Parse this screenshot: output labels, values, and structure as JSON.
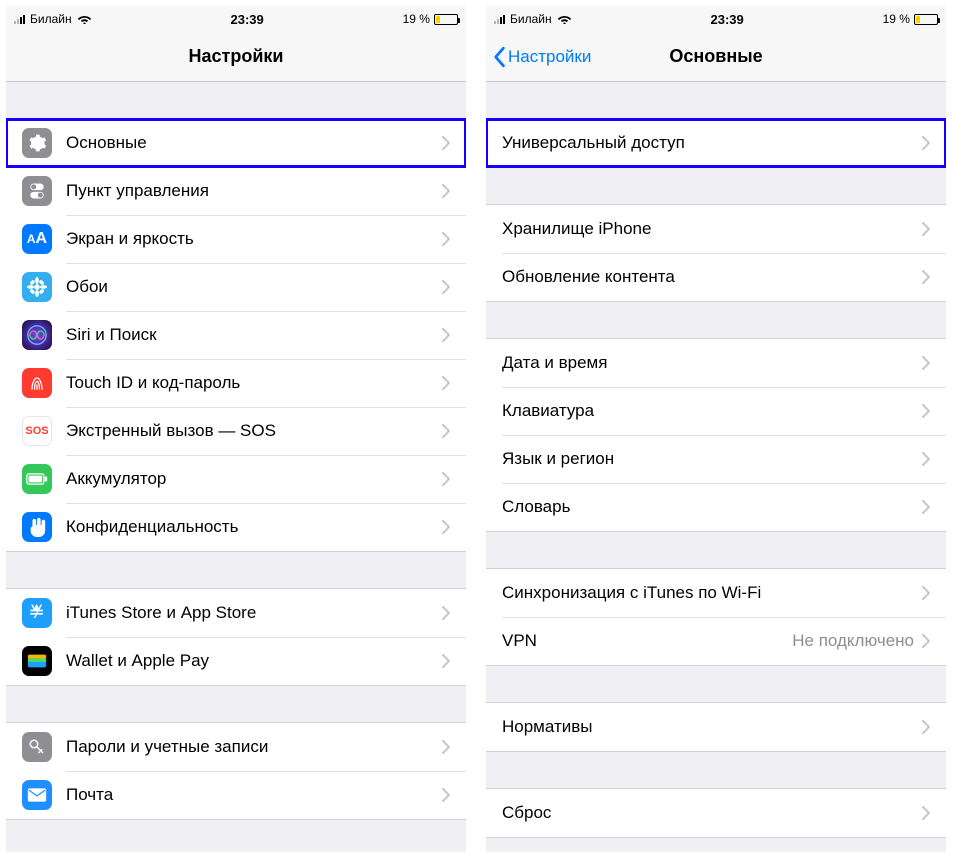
{
  "status": {
    "carrier": "Билайн",
    "time": "23:39",
    "battery_pct_text": "19 %",
    "battery_fill_width": "19%"
  },
  "left": {
    "title": "Настройки",
    "groups": [
      {
        "rows": [
          {
            "icon": "general",
            "label": "Основные",
            "highlight": true
          },
          {
            "icon": "control",
            "label": "Пункт управления"
          },
          {
            "icon": "display",
            "label": "Экран и яркость"
          },
          {
            "icon": "wallpaper",
            "label": "Обои"
          },
          {
            "icon": "siri",
            "label": "Siri и Поиск"
          },
          {
            "icon": "touchid",
            "label": "Touch ID и код-пароль"
          },
          {
            "icon": "sos",
            "label": "Экстренный вызов — SOS"
          },
          {
            "icon": "battery",
            "label": "Аккумулятор"
          },
          {
            "icon": "privacy",
            "label": "Конфиденциальность"
          }
        ]
      },
      {
        "rows": [
          {
            "icon": "appstore",
            "label": "iTunes Store и App Store"
          },
          {
            "icon": "wallet",
            "label": "Wallet и Apple Pay"
          }
        ]
      },
      {
        "rows": [
          {
            "icon": "passwords",
            "label": "Пароли и учетные записи"
          },
          {
            "icon": "mail",
            "label": "Почта"
          }
        ]
      }
    ]
  },
  "right": {
    "back": "Настройки",
    "title": "Основные",
    "groups": [
      {
        "rows": [
          {
            "label": "Универсальный доступ",
            "highlight": true
          }
        ]
      },
      {
        "rows": [
          {
            "label": "Хранилище iPhone"
          },
          {
            "label": "Обновление контента"
          }
        ]
      },
      {
        "rows": [
          {
            "label": "Дата и время"
          },
          {
            "label": "Клавиатура"
          },
          {
            "label": "Язык и регион"
          },
          {
            "label": "Словарь"
          }
        ]
      },
      {
        "rows": [
          {
            "label": "Синхронизация с iTunes по Wi-Fi"
          },
          {
            "label": "VPN",
            "value": "Не подключено"
          }
        ]
      },
      {
        "rows": [
          {
            "label": "Нормативы"
          }
        ]
      },
      {
        "rows": [
          {
            "label": "Сброс"
          }
        ]
      }
    ]
  },
  "icons": {
    "general": "gear",
    "control": "toggles",
    "display": "AA",
    "wallpaper": "flower",
    "siri": "siri",
    "touchid": "fingerprint",
    "sos": "SOS",
    "battery": "battery",
    "privacy": "hand",
    "appstore": "appstore",
    "wallet": "wallet",
    "passwords": "key",
    "mail": "envelope"
  }
}
